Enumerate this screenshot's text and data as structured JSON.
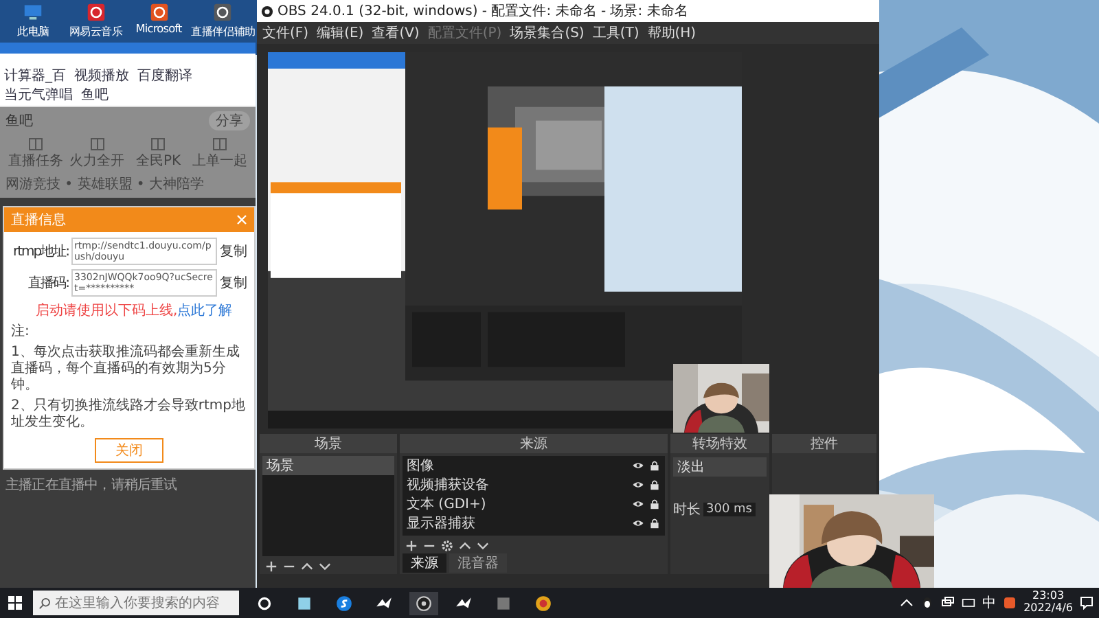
{
  "desktop_icons": [
    {
      "label": "此电脑",
      "kind": "computer"
    },
    {
      "label": "网易云音乐",
      "kind": "music"
    },
    {
      "label": "Microsoft",
      "kind": "office"
    },
    {
      "label": "直播伴侣辅助",
      "kind": "tool"
    }
  ],
  "browser": {
    "bookmarks": [
      "计算器_百",
      "视频播放",
      "百度翻译",
      "当元气弹唱",
      "鱼吧"
    ],
    "section_title": "鱼吧",
    "share_button": "分享",
    "features": [
      "直播任务",
      "火力全开",
      "全民PK",
      "上单一起"
    ],
    "breadcrumb": "网游竞技 • 英雄联盟 • 大神陪学"
  },
  "dialog": {
    "title": "直播信息",
    "rtmp_label": "rtmp地址:",
    "rtmp_value": "rtmp://sendtc1.douyu.com/push/douyu",
    "copy_1": "复制",
    "code_label": "直播码:",
    "code_value": "3302nJWQQk7oo9Q?ucSecret=**********",
    "copy_2": "复制",
    "warning": "启动请使用以下码上线,",
    "warning_link": "点此了解",
    "note_title": "注:",
    "notes": [
      "1、每次点击获取推流码都会重新生成直播码，每个直播码的有效期为5分钟。",
      "2、只有切换推流线路才会导致rtmp地址发生变化。"
    ],
    "close_button": "关闭"
  },
  "status_note": "主播正在直播中，请稍后重试",
  "obs": {
    "title": "OBS 24.0.1 (32-bit, windows) - 配置文件: 未命名 - 场景: 未命名",
    "menu": [
      {
        "label": "文件(F)",
        "disabled": false
      },
      {
        "label": "编辑(E)",
        "disabled": false
      },
      {
        "label": "查看(V)",
        "disabled": false
      },
      {
        "label": "配置文件(P)",
        "disabled": true
      },
      {
        "label": "场景集合(S)",
        "disabled": false
      },
      {
        "label": "工具(T)",
        "disabled": false
      },
      {
        "label": "帮助(H)",
        "disabled": false
      }
    ],
    "scenes_title": "场景",
    "scenes": [
      {
        "label": "场景",
        "selected": true
      }
    ],
    "sources_title": "来源",
    "sources": [
      {
        "label": "图像"
      },
      {
        "label": "视频捕获设备"
      },
      {
        "label": "文本 (GDI+)"
      },
      {
        "label": "显示器捕获"
      }
    ],
    "source_tabs": [
      {
        "label": "来源",
        "selected": true
      },
      {
        "label": "混音器",
        "selected": false
      }
    ],
    "transitions_title": "转场特效",
    "transition": "淡出",
    "duration_label": "时长",
    "duration": "300 ms",
    "controls_title": "控件"
  },
  "taskbar": {
    "search_placeholder": "在这里输入你要搜索的内容",
    "input_method": "中",
    "time": "23:03",
    "date": "2022/4/6"
  }
}
